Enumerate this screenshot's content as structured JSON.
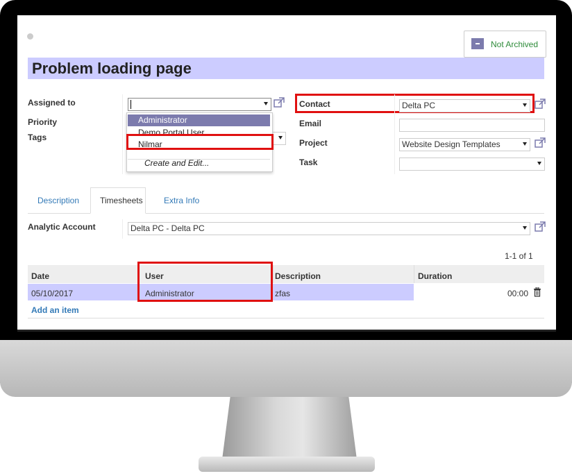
{
  "record": {
    "status_button": "Not Archived",
    "title": "Problem loading page"
  },
  "form": {
    "assigned_to_label": "Assigned to",
    "assigned_to_value": "",
    "priority_label": "Priority",
    "tags_label": "Tags",
    "contact_label": "Contact",
    "contact_value": "Delta PC",
    "email_label": "Email",
    "email_value": "",
    "project_label": "Project",
    "project_value": "Website Design Templates",
    "task_label": "Task",
    "task_value": ""
  },
  "dropdown": {
    "items": [
      "Administrator",
      "Demo Portal User",
      "Nilmar"
    ],
    "create_edit": "Create and Edit..."
  },
  "tabs": [
    "Description",
    "Timesheets",
    "Extra Info"
  ],
  "timesheets": {
    "analytic_label": "Analytic Account",
    "analytic_value": "Delta PC - Delta PC",
    "pager": "1-1 of 1",
    "columns": [
      "Date",
      "User",
      "Description",
      "Duration"
    ],
    "rows": [
      {
        "date": "05/10/2017",
        "user": "Administrator",
        "description": "zfas",
        "duration": "00:00"
      }
    ],
    "add_item": "Add an item"
  },
  "colors": {
    "accent": "#7c7bad",
    "title_bg": "#ccccff",
    "highlight_border": "#e01010",
    "link": "#337ab7",
    "archived_text": "#2e8b3a"
  }
}
